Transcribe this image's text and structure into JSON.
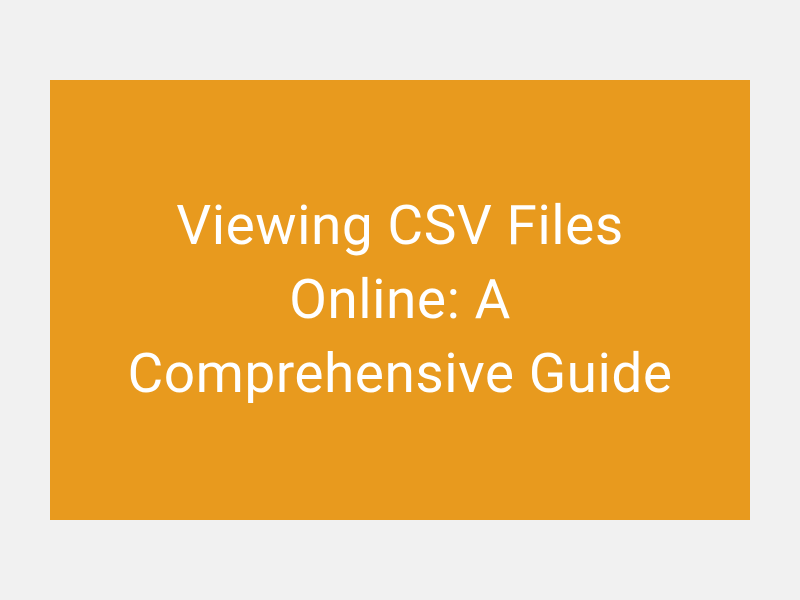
{
  "banner": {
    "title": "Viewing CSV Files Online: A Comprehensive Guide"
  }
}
